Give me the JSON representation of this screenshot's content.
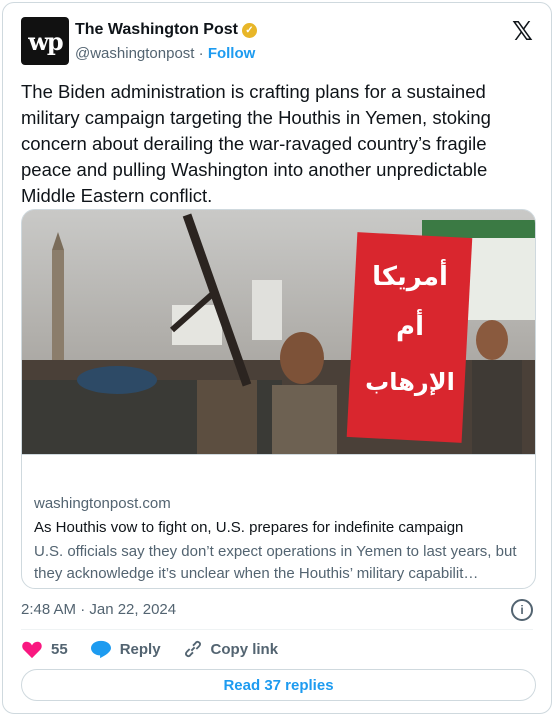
{
  "account": {
    "avatar_text": "wp",
    "name": "The Washington Post",
    "handle": "@washingtonpost",
    "separator": "·",
    "follow_label": "Follow"
  },
  "tweet": {
    "text": "The Biden administration is crafting plans for a sustained military campaign targeting the Houthis in Yemen, stoking concern about derailing the war-ravaged country’s fragile peace and pulling Washington into another unpredictable Middle Eastern conflict."
  },
  "link_card": {
    "sign_text_1": "أمريكا",
    "sign_text_2": "أم",
    "sign_text_3": "الإرهاب",
    "domain": "washingtonpost.com",
    "title": "As Houthis vow to fight on, U.S. prepares for indefinite campaign",
    "description": "U.S. officials say they don’t expect operations in Yemen to last years, but they acknowledge it’s unclear when the Houthis’ military capabilit…"
  },
  "meta": {
    "timestamp": "2:48 AM · Jan 22, 2024"
  },
  "actions": {
    "like_count": "55",
    "reply_label": "Reply",
    "copy_label": "Copy link",
    "read_replies_label": "Read 37 replies"
  },
  "colors": {
    "accent": "#1d9bf0",
    "like": "#f91880",
    "verified": "#e8b628"
  },
  "icons": [
    "x-logo-icon",
    "verified-badge-icon",
    "info-icon",
    "heart-icon",
    "reply-bubble-icon",
    "link-icon"
  ]
}
